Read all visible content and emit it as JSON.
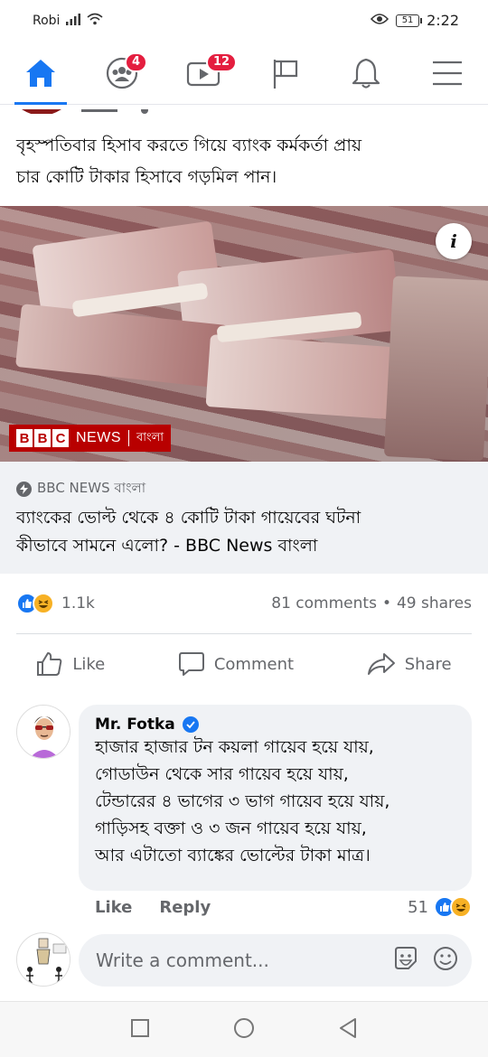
{
  "status_bar": {
    "carrier": "Robi",
    "battery": "51",
    "time": "2:22"
  },
  "top_nav": {
    "items": [
      {
        "name": "home",
        "active": true,
        "badge": ""
      },
      {
        "name": "groups",
        "active": false,
        "badge": "4"
      },
      {
        "name": "watch",
        "active": false,
        "badge": "12"
      },
      {
        "name": "pages",
        "active": false,
        "badge": ""
      },
      {
        "name": "notifications",
        "active": false,
        "badge": ""
      },
      {
        "name": "menu",
        "active": false,
        "badge": ""
      }
    ]
  },
  "post": {
    "text_line1": "বৃহস্পতিবার হিসাব করতে গিয়ে ব্যাংক কর্মকর্তা প্রায়",
    "text_line2": "চার কোটি টাকার হিসাবে গড়মিল পান।",
    "image_logo": {
      "bbc": [
        "B",
        "B",
        "C"
      ],
      "news": "NEWS",
      "bangla": "বাংলা"
    },
    "link": {
      "source": "BBC NEWS বাংলা",
      "title_line1": "ব্যাংকের ভোল্ট থেকে ৪ কোটি টাকা গায়েবের ঘটনা",
      "title_line2": "কীভাবে সামনে এলো? - BBC News বাংলা"
    },
    "reactions_count": "1.1k",
    "comments_count": "81 comments",
    "shares_count": "49 shares",
    "actions": {
      "like": "Like",
      "comment": "Comment",
      "share": "Share"
    }
  },
  "comment": {
    "author": "Mr. Fotka",
    "lines": [
      "হাজার হাজার টন কয়লা গায়েব হয়ে যায়,",
      "গোডাউন থেকে সার গায়েব হয়ে যায়,",
      "টেন্ডারের ৪ ভাগের ৩ ভাগ গায়েব হয়ে যায়,",
      "গাড়িসহ বক্তা ও ৩ জন গায়েব হয়ে যায়,",
      "আর এটাতো ব্যাঙ্কের ভোল্টের টাকা মাত্র।"
    ],
    "like_label": "Like",
    "reply_label": "Reply",
    "reaction_count": "51"
  },
  "composer": {
    "placeholder": "Write a comment..."
  },
  "colors": {
    "accent": "#1877f2",
    "badge": "#e41e3f",
    "bbc_red": "#b80000"
  }
}
